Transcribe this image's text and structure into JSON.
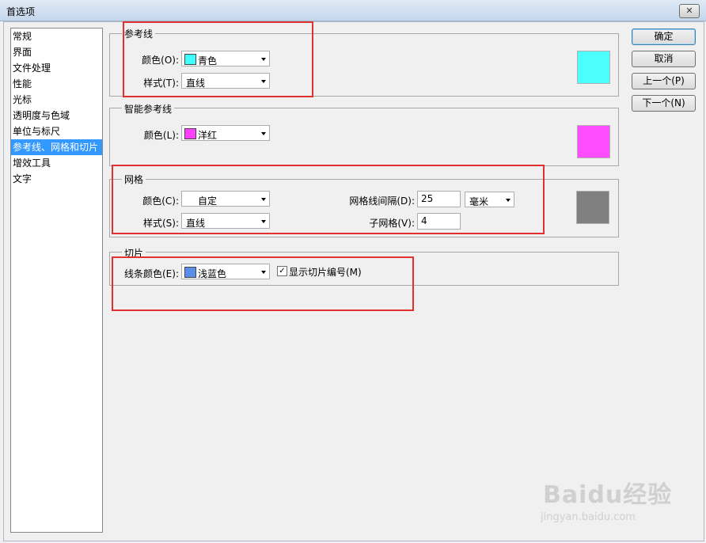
{
  "window": {
    "title": "首选项",
    "close_glyph": "✕"
  },
  "nav": {
    "items": [
      {
        "label": "常规"
      },
      {
        "label": "界面"
      },
      {
        "label": "文件处理"
      },
      {
        "label": "性能"
      },
      {
        "label": "光标"
      },
      {
        "label": "透明度与色域"
      },
      {
        "label": "单位与标尺"
      },
      {
        "label": "参考线、网格和切片"
      },
      {
        "label": "增效工具"
      },
      {
        "label": "文字"
      }
    ],
    "selected_index": 7
  },
  "guides": {
    "legend": "参考线",
    "color_label": "颜色(O):",
    "color_value": "青色",
    "color_swatch": "#40ffff",
    "style_label": "样式(T):",
    "style_value": "直线",
    "preview_color": "#4cffff"
  },
  "smart_guides": {
    "legend": "智能参考线",
    "color_label": "颜色(L):",
    "color_value": "洋红",
    "color_swatch": "#ff40ff",
    "preview_color": "#ff4cff"
  },
  "grid": {
    "legend": "网格",
    "color_label": "颜色(C):",
    "color_value": "自定",
    "style_label": "样式(S):",
    "style_value": "直线",
    "gridline_label": "网格线间隔(D):",
    "gridline_value": "25",
    "unit_value": "毫米",
    "subdiv_label": "子网格(V):",
    "subdiv_value": "4",
    "preview_color": "#808080"
  },
  "slices": {
    "legend": "切片",
    "line_color_label": "线条颜色(E):",
    "line_color_value": "浅蓝色",
    "line_color_swatch": "#5a8ee8",
    "show_numbers_label": "显示切片编号(M)",
    "show_numbers_checked": true,
    "check_glyph": "✓"
  },
  "buttons": {
    "ok": "确定",
    "cancel": "取消",
    "prev": "上一个(P)",
    "next": "下一个(N)"
  },
  "watermark": {
    "brand": "Baidu经验",
    "url": "jingyan.baidu.com"
  },
  "colors": {
    "highlight_box": "#e03030",
    "selection": "#3399ff"
  }
}
